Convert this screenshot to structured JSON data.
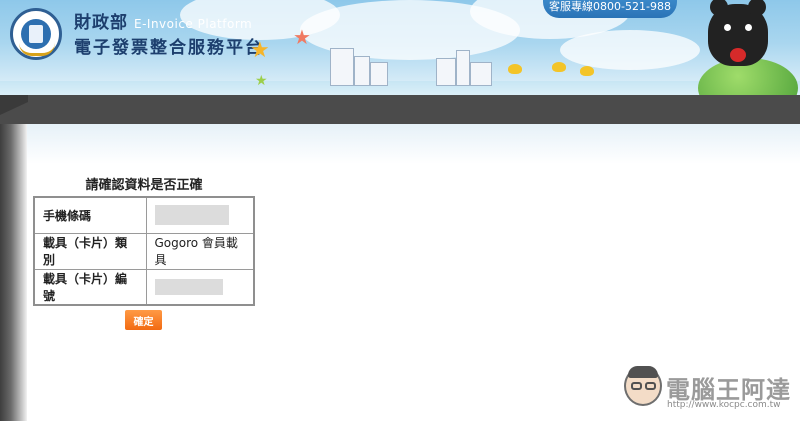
{
  "header": {
    "ministry": "財政部",
    "platform_en": "E-Invoice Platform",
    "platform_name": "電子發票整合服務平台",
    "hotline": "客服專線0800-521-988"
  },
  "confirm": {
    "title": "請確認資料是否正確",
    "rows": [
      {
        "label": "手機條碼",
        "value": ""
      },
      {
        "label": "載具（卡片）類別",
        "value": "Gogoro 會員載具"
      },
      {
        "label": "載具（卡片）編號",
        "value": ""
      }
    ],
    "confirm_button": "確定"
  },
  "watermark": {
    "name": "電腦王阿達",
    "url": "http://www.kocpc.com.tw"
  },
  "colors": {
    "button": "#f26a12",
    "band": "#4b4b4b",
    "header_sky": "#a9d6ef",
    "brand_text": "#1d3f6e"
  }
}
